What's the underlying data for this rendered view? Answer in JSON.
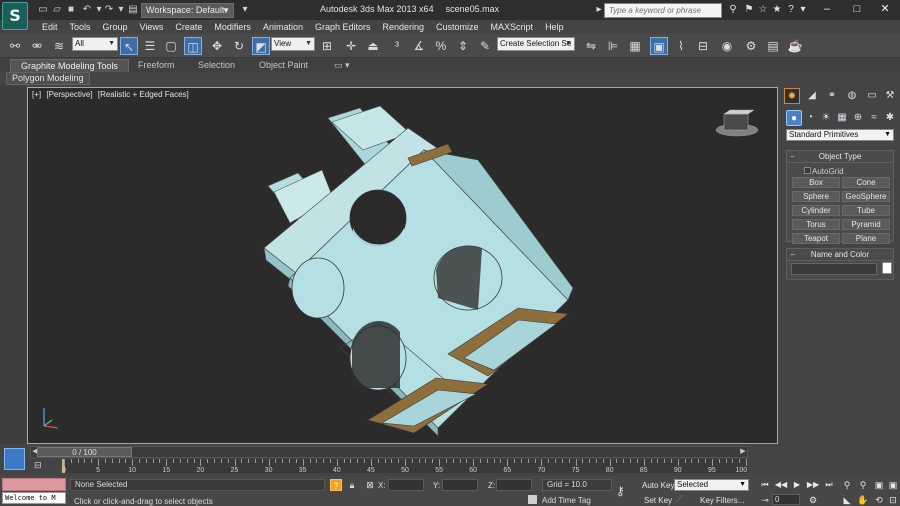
{
  "title_bar": {
    "app_name": "Autodesk 3ds Max  2013 x64",
    "file_name": "scene05.max",
    "workspace": "Workspace: Default",
    "search_placeholder": "Type a keyword or phrase",
    "logo_icon": "3ds-max-logo"
  },
  "menu": [
    "Edit",
    "Tools",
    "Group",
    "Views",
    "Create",
    "Modifiers",
    "Animation",
    "Graph Editors",
    "Rendering",
    "Customize",
    "MAXScript",
    "Help"
  ],
  "toolbar": {
    "selection_filter": "All",
    "reference_coord": "View",
    "named_selection": "Create Selection Se"
  },
  "ribbon": {
    "tabs": [
      "Graphite Modeling Tools",
      "Freeform",
      "Selection",
      "Object Paint"
    ],
    "active_tab": "Graphite Modeling Tools",
    "sub_tab": "Polygon Modeling"
  },
  "viewport": {
    "label_plus": "[+]",
    "label_view": "[Perspective]",
    "label_shading": "[Realistic + Edged Faces]",
    "border_color": "#cfa63c"
  },
  "command_panel": {
    "category": "Standard Primitives",
    "object_type_title": "Object Type",
    "autogrid": "AutoGrid",
    "primitives": [
      "Box",
      "Cone",
      "Sphere",
      "GeoSphere",
      "Cylinder",
      "Tube",
      "Torus",
      "Pyramid",
      "Teapot",
      "Plane"
    ],
    "name_color_title": "Name and Color"
  },
  "timeline": {
    "slider_label": "0 / 100",
    "ticks": [
      "0",
      "5",
      "10",
      "15",
      "20",
      "25",
      "30",
      "35",
      "40",
      "45",
      "50",
      "55",
      "60",
      "65",
      "70",
      "75",
      "80",
      "85",
      "90",
      "95",
      "100"
    ],
    "current_frame": "0"
  },
  "status": {
    "maxscript": "Welcome to M",
    "selection": "None Selected",
    "prompt": "Click or click-and-drag to select objects",
    "x_label": "X:",
    "y_label": "Y:",
    "z_label": "Z:",
    "grid": "Grid = 10.0",
    "add_time_tag": "Add Time Tag",
    "auto_key": "Auto Key",
    "set_key": "Set Key",
    "selected": "Selected",
    "key_filters": "Key Filters..."
  }
}
